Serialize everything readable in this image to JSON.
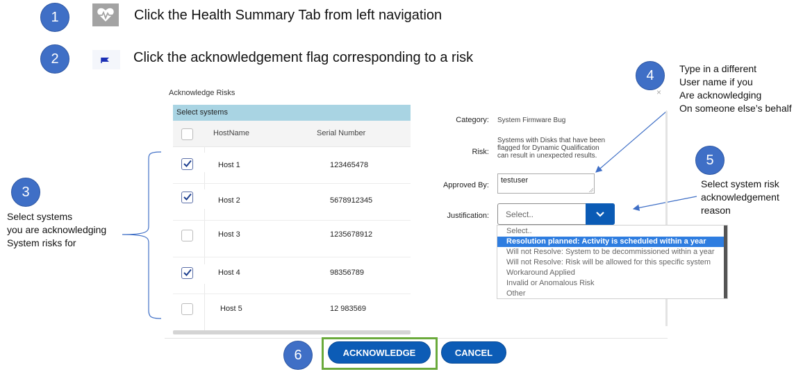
{
  "steps": [
    {
      "number": "1",
      "text": "Click the Health Summary Tab from left navigation",
      "icon": "heartbeat-icon"
    },
    {
      "number": "2",
      "text": "Click the acknowledgement flag corresponding to a risk",
      "icon": "flag-icon"
    },
    {
      "number": "3",
      "text": "Select systems\nyou are acknowledging\nSystem risks for"
    },
    {
      "number": "4",
      "text": "Type in a different\nUser name if you\nAre acknowledging\nOn someone else’s behalf"
    },
    {
      "number": "5",
      "text": "Select system risk\nacknowledgement\nreason"
    },
    {
      "number": "6"
    }
  ],
  "dialog": {
    "title": "Acknowledge Risks",
    "close": "×",
    "systems": {
      "header": "Select systems",
      "columns": {
        "hostname": "HostName",
        "serial": "Serial Number"
      },
      "rows": [
        {
          "host": "Host 1",
          "serial": "123465478",
          "checked": true
        },
        {
          "host": "Host 2",
          "serial": "5678912345",
          "checked": true
        },
        {
          "host": "Host 3",
          "serial": "1235678912",
          "checked": false
        },
        {
          "host": "Host 4",
          "serial": "98356789",
          "checked": true
        },
        {
          "host": "Host 5",
          "serial": "12 983569",
          "checked": false
        }
      ]
    },
    "details": {
      "category_label": "Category:",
      "category_value": "System Firmware Bug",
      "risk_label": "Risk:",
      "risk_value": "Systems with Disks that have been flagged for Dynamic Qualification can result in unexpected results.",
      "approved_label": "Approved By:",
      "approved_value": "testuser",
      "justification_label": "Justification:",
      "justification_placeholder": "Select..",
      "justification_options": [
        "Select..",
        "Resolution planned: Activity is scheduled within a year",
        "Will not Resolve: System to be decommissioned within a year",
        "Will not Resolve: Risk will be allowed for this specific system",
        "Workaround Applied",
        "Invalid or Anomalous Risk",
        "Other"
      ],
      "selected_option_index": 1
    },
    "buttons": {
      "acknowledge": "ACKNOWLEDGE",
      "cancel": "CANCEL"
    }
  },
  "colors": {
    "badge": "#3f6fc6",
    "primary_button": "#0c5cb6",
    "highlight_frame": "#6aaa3b",
    "systems_header": "#a9d4e3",
    "selected_option": "#2e7de0"
  }
}
